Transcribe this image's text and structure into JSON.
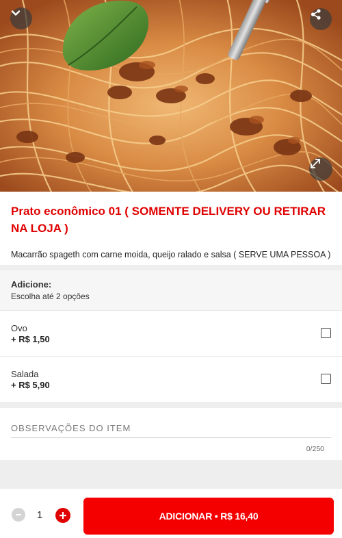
{
  "hero": {
    "image_name": "spaghetti-bolognese-photo",
    "back_icon": "chevron-down-icon",
    "share_icon": "share-icon",
    "expand_icon": "expand-icon"
  },
  "product": {
    "title": "Prato econômico 01 ( SOMENTE DELIVERY OU RETIRAR NA LOJA )",
    "description": "Macarrão spageth com carne moida, queijo ralado e salsa ( SERVE UMA PESSOA )"
  },
  "addons": {
    "title": "Adicione:",
    "subtitle": "Escolha até 2 opções",
    "options": [
      {
        "name": "Ovo",
        "price": "+ R$ 1,50",
        "checked": false
      },
      {
        "name": "Salada",
        "price": "+ R$ 5,90",
        "checked": false
      }
    ]
  },
  "observations": {
    "placeholder": "OBSERVAÇÕES DO ITEM",
    "value": "",
    "counter": "0/250"
  },
  "footer": {
    "quantity": "1",
    "add_button_label": "ADICIONAR • R$ 16,40"
  },
  "colors": {
    "accent_red": "#f40000",
    "title_red": "#e00000",
    "section_gray": "#eeeeee"
  }
}
